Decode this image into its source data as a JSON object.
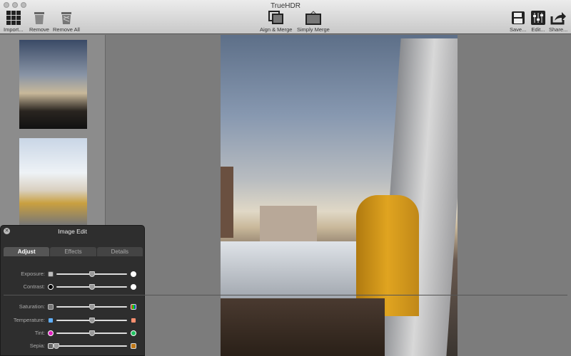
{
  "window": {
    "title": "TrueHDR"
  },
  "toolbar": {
    "import": "Import...",
    "remove": "Remove",
    "remove_all": "Remove All",
    "align_merge": "Aign & Merge",
    "simply_merge": "Simply Merge",
    "save": "Save...",
    "edit": "Edit...",
    "share": "Share..."
  },
  "panel": {
    "title": "Image Edit",
    "tabs": [
      "Adjust",
      "Effects",
      "Details"
    ],
    "active_tab": "Adjust",
    "sliders": [
      {
        "label": "Exposure:",
        "value": 0.5
      },
      {
        "label": "Contrast:",
        "value": 0.5
      },
      {
        "label": "Saturation:",
        "value": 0.5
      },
      {
        "label": "Temperature:",
        "value": 0.5
      },
      {
        "label": "Tint:",
        "value": 0.5
      },
      {
        "label": "Sepia:",
        "value": 0.0
      }
    ]
  },
  "colors": {
    "tint_left": "#e020c0",
    "tint_right": "#20c060",
    "temp_left": "#60b0ff",
    "temp_right": "#ff9070"
  }
}
